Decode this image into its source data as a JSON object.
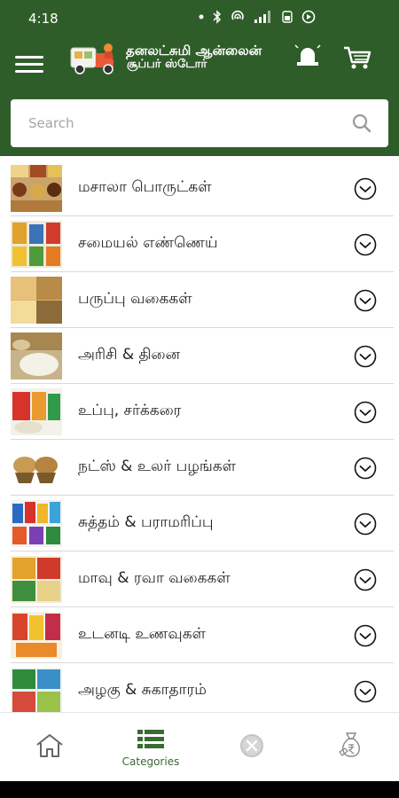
{
  "status_bar": {
    "time": "4:18"
  },
  "header": {
    "brand_line1": "தனலட்சுமி ஆன்லைன்",
    "brand_line2": "சூப்பர் ஸ்டோர்"
  },
  "search": {
    "placeholder": "Search"
  },
  "categories": [
    {
      "label": "மசாலா பொருட்கள்"
    },
    {
      "label": "சமையல் எண்ணெய்"
    },
    {
      "label": "பருப்பு வகைகள்"
    },
    {
      "label": "அரிசி & தினை"
    },
    {
      "label": "உப்பு, சர்க்கரை"
    },
    {
      "label": "நட்ஸ் & உலர் பழங்கள்"
    },
    {
      "label": "சுத்தம் & பராமரிப்பு"
    },
    {
      "label": "மாவு & ரவா வகைகள்"
    },
    {
      "label": "உடனடி உணவுகள்"
    },
    {
      "label": "அழகு & சுகாதாரம்"
    }
  ],
  "bottom_nav": {
    "home_label": "",
    "categories_label": "Categories",
    "offers_label": "",
    "wallet_label": ""
  },
  "colors": {
    "header_green": "#2f5d2a",
    "nav_active": "#3a6b33",
    "divider": "#d9d9d9"
  }
}
